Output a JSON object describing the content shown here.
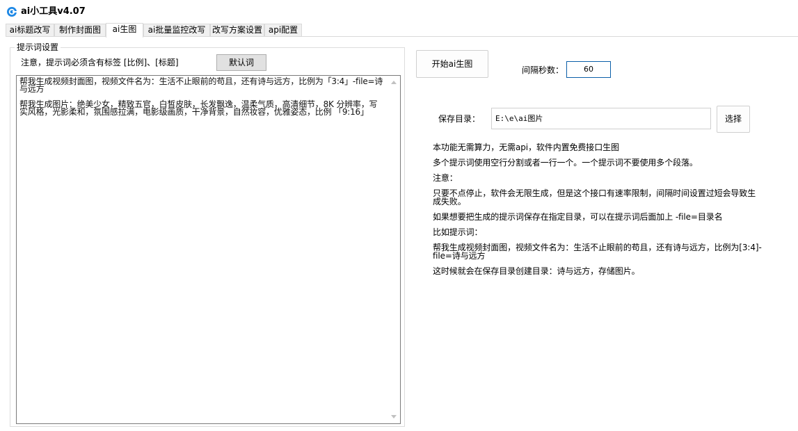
{
  "window": {
    "title": "ai小工具v4.07",
    "icon": "app-logo-icon"
  },
  "tabs": [
    {
      "label": "ai标题改写",
      "active": false
    },
    {
      "label": "制作封面图",
      "active": false
    },
    {
      "label": "ai生图",
      "active": true
    },
    {
      "label": "ai批量监控改写",
      "active": false
    },
    {
      "label": "改写方案设置",
      "active": false
    },
    {
      "label": "api配置",
      "active": false
    }
  ],
  "prompt_settings": {
    "group_title": "提示词设置",
    "notice": "注意，提示词必须含有标签 [比例]、[标题]",
    "default_button": "默认词",
    "text": "帮我生成视频封面图，视频文件名为：生活不止眼前的苟且，还有诗与远方，比例为「3:4」-file=诗与远方\n\n帮我生成图片：绝美少女，精致五官，白皙皮肤，长发飘逸，温柔气质，高清细节，8K 分辨率，写实风格，光影柔和，氛围感拉满，电影级画质，干净背景，自然妆容，优雅姿态，比例 「9:16」"
  },
  "controls": {
    "start_button": "开始ai生图",
    "interval_label": "间隔秒数：",
    "interval_value": "60",
    "save_dir_label": "保存目录：",
    "save_dir_value": "E:\\e\\ai图片",
    "choose_button": "选择"
  },
  "info": {
    "line1": "本功能无需算力，无需api，软件内置免费接口生图",
    "line2": "多个提示词使用空行分割或者一行一个。一个提示词不要使用多个段落。",
    "line3": "注意：",
    "line4": "只要不点停止，软件会无限生成，但是这个接口有速率限制，间隔时间设置过短会导致生成失败。",
    "line5": "如果想要把生成的提示词保存在指定目录，可以在提示词后面加上 -file=目录名",
    "line6": "比如提示词：",
    "line7": "帮我生成视频封面图，视频文件名为：生活不止眼前的苟且，还有诗与远方，比例为[3:4]-file=诗与远方",
    "line8": "这时候就会在保存目录创建目录：诗与远方，存储图片。"
  },
  "colors": {
    "accent": "#0a5ea8",
    "button_bg": "#e1e1e1",
    "logo": "#1e88e5"
  }
}
